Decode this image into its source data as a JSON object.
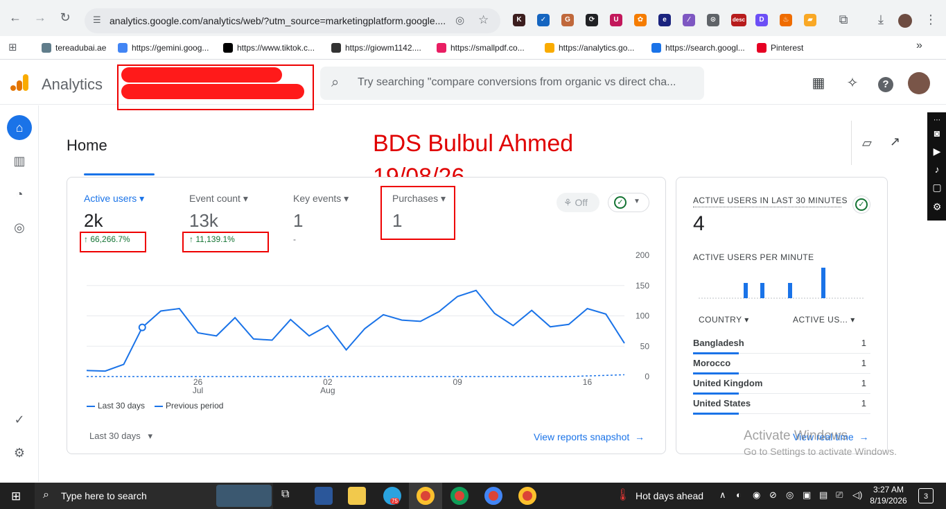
{
  "browser": {
    "url": "analytics.google.com/analytics/web/?utm_source=marketingplatform.google....",
    "extensions": [
      {
        "name": "k-extension-icon",
        "color": "#3c1e1e",
        "glyph": "K"
      },
      {
        "name": "check-extension-icon",
        "color": "#1565c0",
        "glyph": "✓"
      },
      {
        "name": "g-extension-icon",
        "color": "#c0683b",
        "glyph": "G"
      },
      {
        "name": "sync-extension-icon",
        "color": "#202124",
        "glyph": "⟳"
      },
      {
        "name": "u-extension-icon",
        "color": "#c2185b",
        "glyph": "U"
      },
      {
        "name": "sd-extension-icon",
        "color": "#f57c00",
        "glyph": "✿"
      },
      {
        "name": "e-extension-icon",
        "color": "#1a237e",
        "glyph": "e"
      },
      {
        "name": "feather-extension-icon",
        "color": "#7e57c2",
        "glyph": "∕"
      },
      {
        "name": "location-extension-icon",
        "color": "#5f6368",
        "glyph": "⊙"
      },
      {
        "name": "desc-extension-icon",
        "color": "#b71c1c",
        "glyph": "desc"
      },
      {
        "name": "d-extension-icon",
        "color": "#6c4ff6",
        "glyph": "D"
      },
      {
        "name": "fire-extension-icon",
        "color": "#ef6c00",
        "glyph": "♨"
      },
      {
        "name": "tag-extension-icon",
        "color": "#f9a825",
        "glyph": "▰"
      }
    ],
    "bookmarks": [
      {
        "label": "tereadubai.ae",
        "color": "#607d8b"
      },
      {
        "label": "https://gemini.goog...",
        "color": "#4285f4"
      },
      {
        "label": "https://www.tiktok.c...",
        "color": "#000000"
      },
      {
        "label": "https://giowm1142....",
        "color": "#333333"
      },
      {
        "label": "https://smallpdf.co...",
        "color": "#e91e63"
      },
      {
        "label": "https://analytics.go...",
        "color": "#f9ab00"
      },
      {
        "label": "https://search.googl...",
        "color": "#1a73e8"
      },
      {
        "label": "Pinterest",
        "color": "#e60023"
      }
    ]
  },
  "header": {
    "app_title": "Analytics",
    "search_placeholder": "Try searching \"compare conversions from organic vs direct cha..."
  },
  "page": {
    "title": "Home",
    "annotation_name": "BDS Bulbul Ahmed",
    "annotation_date": "19/08/26"
  },
  "metrics": [
    {
      "label": "Active users",
      "value": "2k",
      "change": "↑ 66,266.7%",
      "active": true
    },
    {
      "label": "Event count",
      "value": "13k",
      "change": "↑ 11,139.1%",
      "active": false
    },
    {
      "label": "Key events",
      "value": "1",
      "change": "-",
      "active": false
    },
    {
      "label": "Purchases",
      "value": "1",
      "change": "",
      "active": false
    }
  ],
  "toggle_label": "Off",
  "chart_data": {
    "type": "line",
    "x_tick_labels": [
      {
        "day": "26",
        "month": "Jul",
        "index": 6
      },
      {
        "day": "02",
        "month": "Aug",
        "index": 13
      },
      {
        "day": "09",
        "month": "",
        "index": 20
      },
      {
        "day": "16",
        "month": "",
        "index": 27
      }
    ],
    "ylim": [
      0,
      200
    ],
    "yticks": [
      0,
      50,
      100,
      150,
      200
    ],
    "series": [
      {
        "name": "Last 30 days",
        "style": "solid",
        "color": "#1a73e8",
        "values": [
          10,
          9,
          20,
          81,
          108,
          112,
          72,
          67,
          97,
          62,
          60,
          94,
          67,
          84,
          44,
          79,
          102,
          93,
          91,
          107,
          132,
          142,
          104,
          84,
          109,
          82,
          86,
          112,
          103,
          55
        ]
      },
      {
        "name": "Previous period",
        "style": "dashed",
        "color": "#1a73e8",
        "values": [
          0,
          0,
          0,
          0,
          0,
          0,
          0,
          0,
          0,
          0,
          0,
          0,
          0,
          0,
          0,
          0,
          0,
          0,
          0,
          0,
          0,
          0,
          0,
          0,
          0,
          0,
          0,
          1,
          2,
          3
        ]
      }
    ],
    "highlight_index": 3,
    "legend_position": "bottom-left",
    "grid": true
  },
  "date_range_label": "Last 30 days",
  "view_snapshot_label": "View reports snapshot",
  "realtime": {
    "title": "ACTIVE USERS IN LAST 30 MINUTES",
    "value": "4",
    "per_minute_label": "ACTIVE USERS PER MINUTE",
    "per_minute_values": [
      0,
      0,
      0,
      0,
      0,
      0,
      0,
      0,
      1,
      0,
      0,
      1,
      0,
      0,
      0,
      0,
      1,
      0,
      0,
      0,
      0,
      0,
      2,
      0,
      0,
      0,
      0,
      0,
      0,
      0
    ],
    "col_country": "COUNTRY",
    "col_users": "ACTIVE US...",
    "rows": [
      {
        "country": "Bangladesh",
        "users": "1"
      },
      {
        "country": "Morocco",
        "users": "1"
      },
      {
        "country": "United Kingdom",
        "users": "1"
      },
      {
        "country": "United States",
        "users": "1"
      }
    ],
    "view_realtime_label": "View real time"
  },
  "windows": {
    "activate_title": "Activate Windows",
    "activate_sub": "Go to Settings to activate Windows.",
    "search_placeholder": "Type here to search",
    "weather": "Hot days ahead",
    "time": "3:27 AM",
    "date": "8/19/2026",
    "notification_count": "3",
    "telegram_badge": "75"
  }
}
